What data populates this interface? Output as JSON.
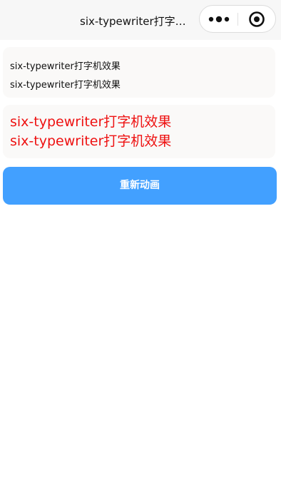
{
  "nav_bar": {
    "title": "six-typewriter打字机效果",
    "capsule": {
      "more_icon": "more-dots-icon",
      "close_icon": "target-circle-icon"
    }
  },
  "small_card": {
    "lines": [
      "six-typewriter打字机效果",
      "six-typewriter打字机效果"
    ]
  },
  "large_card": {
    "lines": [
      "six-typewriter打字机效果",
      "six-typewriter打字机效果"
    ],
    "text_color": "#ee1111"
  },
  "restart_button": {
    "label": "重新动画",
    "color": "#42a0ff"
  }
}
